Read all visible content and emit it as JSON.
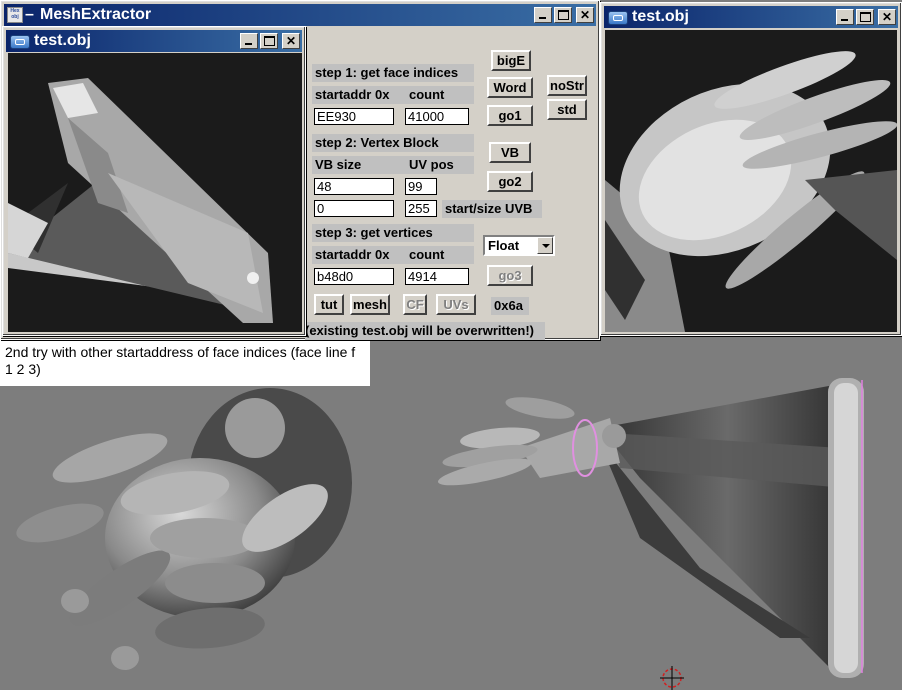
{
  "colors": {
    "titlebar_active": "#0a246a",
    "titlebar_gradient_end": "#3a6ea5",
    "window_face": "#d4d0c8",
    "viewport_bg": "#1b1b1b",
    "scene_bg": "#7d7d7d"
  },
  "main_window": {
    "title": "MeshExtractor",
    "icon_text": "Hex obj",
    "icon": "hex-obj-app-icon",
    "title_suffix": "–",
    "controls": [
      "minimize-icon",
      "maximize-icon",
      "close-icon"
    ],
    "step1": {
      "label": "step 1: get face indices",
      "startaddr_label": "startaddr 0x",
      "count_label": "count",
      "startaddr": "EE930",
      "count": "41000"
    },
    "step2": {
      "label": "step 2: Vertex Block",
      "vb_size_label": "VB size",
      "uv_pos_label": "UV pos",
      "vb_size": "48",
      "uv_pos": "99",
      "uvb_start": "0",
      "uvb_size": "255",
      "uvb_label": "start/size UVB"
    },
    "step3": {
      "label": "step 3: get vertices",
      "startaddr_label": "startaddr 0x",
      "count_label": "count",
      "startaddr": "b48d0",
      "count": "4914"
    },
    "buttons": {
      "bigE": "bigE",
      "word": "Word",
      "go1": "go1",
      "nostr": "noStr",
      "std": "std",
      "vb": "VB",
      "go2": "go2",
      "go3": "go3",
      "tut": "tut",
      "mesh": "mesh",
      "cf": "CF",
      "uvs": "UVs"
    },
    "format_select": "Float",
    "hex_value": "0x6a",
    "warning": "(existing test.obj will be overwritten!)"
  },
  "left_preview": {
    "title": "test.obj",
    "icon": "app-window-icon"
  },
  "right_preview": {
    "title": "test.obj",
    "icon": "app-window-icon"
  },
  "note": {
    "text": "2nd try with other startaddress of face indices (face line f 1 2 3)"
  }
}
